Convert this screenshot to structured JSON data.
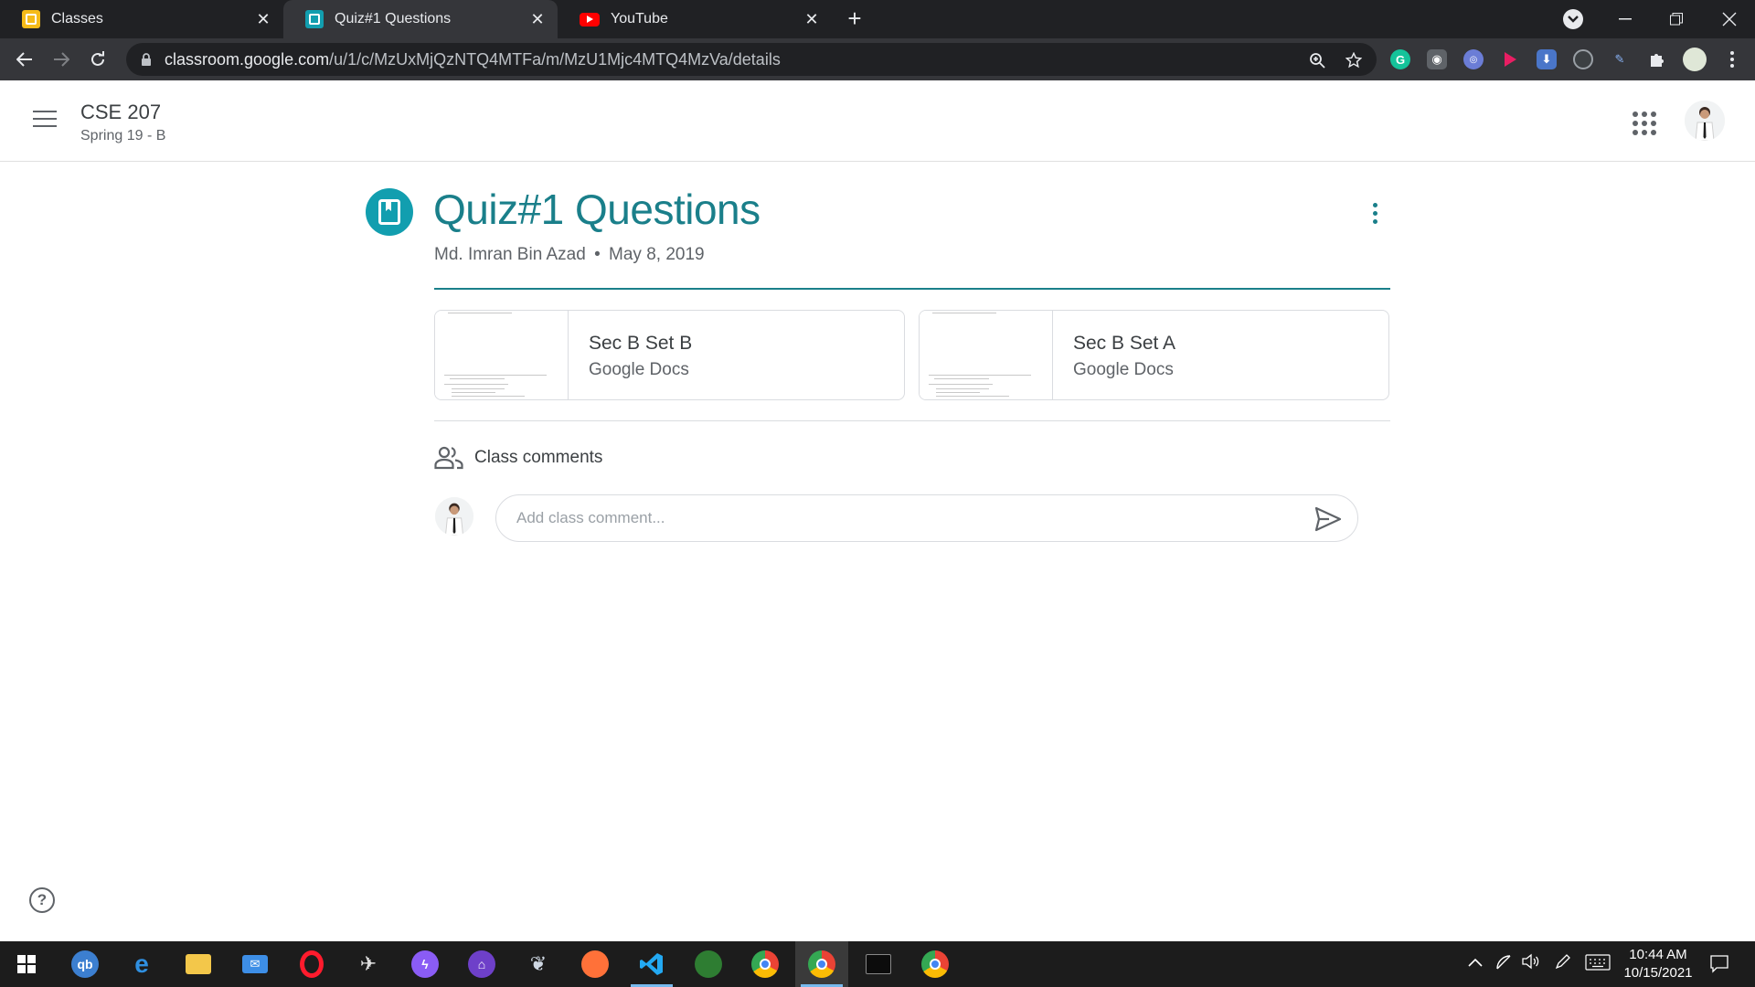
{
  "browser": {
    "tabs": [
      {
        "title": "Classes",
        "active": false,
        "favicon": "classroom-yellow-icon"
      },
      {
        "title": "Quiz#1 Questions",
        "active": true,
        "favicon": "classroom-teal-icon"
      },
      {
        "title": "YouTube",
        "active": false,
        "favicon": "youtube-icon"
      }
    ],
    "url_host": "classroom.google.com",
    "url_path": "/u/1/c/MzUxMjQzNTQ4MTFa/m/MzU1Mjc4MTQ4MzVa/details"
  },
  "course": {
    "title": "CSE 207",
    "section": "Spring 19 - B"
  },
  "assignment": {
    "title": "Quiz#1 Questions",
    "author": "Md. Imran Bin Azad",
    "separator": "•",
    "date": "May 8, 2019",
    "attachments": [
      {
        "title": "Sec B Set B",
        "type": "Google Docs"
      },
      {
        "title": "Sec B Set A",
        "type": "Google Docs"
      }
    ]
  },
  "comments": {
    "label": "Class comments",
    "placeholder": "Add class comment..."
  },
  "taskbar": {
    "time": "10:44 AM",
    "date": "10/15/2021"
  },
  "colors": {
    "accent": "#1a7f8a",
    "icon_bg": "#129eaf"
  }
}
